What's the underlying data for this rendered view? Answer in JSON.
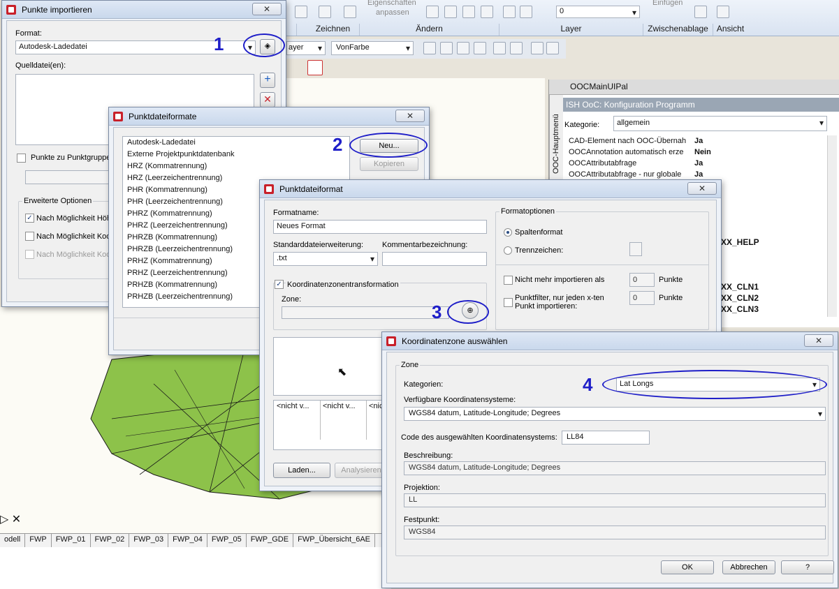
{
  "ribbon": {
    "top_labels": [
      "Eigenschaften",
      "anpassen",
      "Einfügen"
    ],
    "layer_value": "0",
    "groups": [
      "Zeichnen",
      "Ändern",
      "Layer",
      "Zwischenablage",
      "Ansicht"
    ],
    "props": {
      "layer": "ayer",
      "color": "VonFarbe"
    }
  },
  "palette": {
    "title": "OOCMainUIPal",
    "side_tab": "OOC-Hauptmenü",
    "header": "ISH OoC: Konfiguration Programm",
    "kategorie_label": "Kategorie:",
    "kategorie_value": "allgemein",
    "rows": [
      {
        "name": "CAD-Element nach OOC-Übernah",
        "value": "Ja"
      },
      {
        "name": "OOCAnnotation automatisch erze",
        "value": "Nein"
      },
      {
        "name": "OOCAttributabfrage",
        "value": "Ja"
      },
      {
        "name": "OOCAttributabfrage - nur globale",
        "value": "Ja"
      }
    ],
    "right_items": [
      "XX_HELP",
      "XX_CLN1",
      "XX_CLN2",
      "XX_CLN3"
    ]
  },
  "layout_tabs": [
    "odell",
    "FWP",
    "FWP_01",
    "FWP_02",
    "FWP_03",
    "FWP_04",
    "FWP_05",
    "FWP_GDE",
    "FWP_Übersicht_6AE"
  ],
  "dlg_import": {
    "title": "Punkte importieren",
    "close": "✕",
    "format_label": "Format:",
    "format_value": "Autodesk-Ladedatei",
    "quelle_label": "Quelldatei(en):",
    "punktgruppe": "Punkte zu Punktgruppe h",
    "erweitert": "Erweiterte Optionen",
    "opt1": "Nach Möglichkeit Höhe",
    "opt2": "Nach Möglichkeit Koord",
    "opt3": "Nach Möglichkeit Koord"
  },
  "dlg_formate": {
    "title": "Punktdateiformate",
    "close": "✕",
    "items": [
      "Autodesk-Ladedatei",
      "Externe Projektpunktdatenbank",
      "HRZ (Kommatrennung)",
      "HRZ (Leerzeichentrennung)",
      "PHR (Kommatrennung)",
      "PHR (Leerzeichentrennung)",
      "PHRZ (Kommatrennung)",
      "PHRZ (Leerzeichentrennung)",
      "PHRZB (Kommatrennung)",
      "PHRZB (Leerzeichentrennung)",
      "PRHZ (Kommatrennung)",
      "PRHZ (Leerzeichentrennung)",
      "PRHZB (Kommatrennung)",
      "PRHZB (Leerzeichentrennung)"
    ],
    "btn_neu": "Neu...",
    "btn_kopieren": "Kopieren"
  },
  "dlg_format": {
    "title": "Punktdateiformat",
    "close": "✕",
    "formatname_label": "Formatname:",
    "formatname_value": "Neues Format",
    "ext_label": "Standarddateierweiterung:",
    "ext_value": ".txt",
    "comment_label": "Kommentarbezeichnung:",
    "koord_check": "Koordinatenzonentransformation",
    "zone_label": "Zone:",
    "optionen_title": "Formatoptionen",
    "spalten": "Spaltenformat",
    "trenn": "Trennzeichen:",
    "nicht_mehr": "Nicht mehr importieren als",
    "nicht_mehr_val": "0",
    "punkte1": "Punkte",
    "filter_l1": "Punktfilter, nur jeden x-ten",
    "filter_l2": "Punkt importieren:",
    "filter_val": "0",
    "punkte2": "Punkte",
    "col1": "<nicht v...",
    "col2": "<nicht v...",
    "col3": "<nic",
    "btn_laden": "Laden...",
    "btn_analysieren": "Analysieren"
  },
  "dlg_zone": {
    "title": "Koordinatenzone auswählen",
    "close": "✕",
    "zone_group": "Zone",
    "kat_label": "Kategorien:",
    "kat_value": "Lat Longs",
    "verf_label": "Verfügbare Koordinatensysteme:",
    "verf_value": "WGS84 datum, Latitude-Longitude; Degrees",
    "code_label": "Code des ausgewählten Koordinatensystems:",
    "code_value": "LL84",
    "beschr_label": "Beschreibung:",
    "beschr_value": "WGS84 datum, Latitude-Longitude; Degrees",
    "proj_label": "Projektion:",
    "proj_value": "LL",
    "fest_label": "Festpunkt:",
    "fest_value": "WGS84",
    "btn_ok": "OK",
    "btn_cancel": "Abbrechen",
    "btn_help": "?"
  },
  "annotations": [
    "1",
    "2",
    "3",
    "4"
  ]
}
